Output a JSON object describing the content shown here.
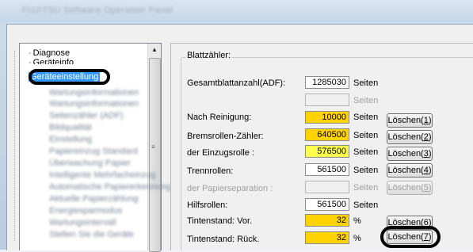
{
  "window": {
    "title": "FUJITSU Software Operation Panel"
  },
  "tree": {
    "items": [
      {
        "label": "Diagnose",
        "blur": false
      },
      {
        "label": "Geräteinfo",
        "blur": false
      },
      {
        "label": "Geräteeinstellung",
        "selected": true
      },
      {
        "label": "Wartungsinformationen"
      },
      {
        "label": "Wartungsinformationen"
      },
      {
        "label": "Seitenzähler (ADF)"
      },
      {
        "label": "Bildqualität"
      },
      {
        "label": "Einstellung"
      },
      {
        "label": "Papiereinzug Standard"
      },
      {
        "label": "Überwachung Papier"
      },
      {
        "label": "Intelligente Mehrfacheinzug"
      },
      {
        "label": "Automatische Papiererkennung"
      },
      {
        "label": "Aktuelle Papierzählung"
      },
      {
        "label": "Energiesparmodus"
      },
      {
        "label": "Wartungsintervall"
      },
      {
        "label": "Stellen Sie die Geräte"
      }
    ]
  },
  "counter": {
    "group_title": "Blattzähler:",
    "rows": [
      {
        "label": "Gesamtblattanzahl(ADF):",
        "value": "1285030",
        "unit": "Seiten",
        "button": "",
        "style": "white"
      },
      {
        "label": "",
        "value": "",
        "unit": "Seiten",
        "button": "",
        "style": "empty-disabled"
      },
      {
        "label": "Nach Reinigung:",
        "value": "10000",
        "unit": "Seiten",
        "button": "Löschen(1)",
        "btn_text": "Löschen(",
        "btn_key": "1",
        "style": "yellow"
      },
      {
        "label": "Bremsrollen-Zähler:",
        "value": "640500",
        "unit": "Seiten",
        "btn_text": "Löschen(",
        "btn_key": "2",
        "style": "yellow"
      },
      {
        "label": "der Einzugsrolle :",
        "value": "576500",
        "unit": "Seiten",
        "btn_text": "Löschen(",
        "btn_key": "3",
        "style": "lightyellow"
      },
      {
        "label": "Trennrollen:",
        "value": "561500",
        "unit": "Seiten",
        "btn_text": "Löschen(",
        "btn_key": "4",
        "style": "white"
      },
      {
        "label": "der Papierseparation :",
        "value": "",
        "unit": "Seiten",
        "btn_text": "Löschen(",
        "btn_key": "5",
        "style": "disabled"
      },
      {
        "label": "Hilfsrollen:",
        "value": "561500",
        "unit": "Seiten",
        "style": "white"
      },
      {
        "label": "Tintenstand: Vor.",
        "value": "32",
        "unit": "%",
        "btn_text": "Löschen(",
        "btn_key": "6",
        "style": "yellow"
      },
      {
        "label": "Tintenstand: Rück.",
        "value": "32",
        "unit": "%",
        "btn_text": "Löschen(",
        "btn_key": "7",
        "style": "yellow"
      }
    ]
  }
}
